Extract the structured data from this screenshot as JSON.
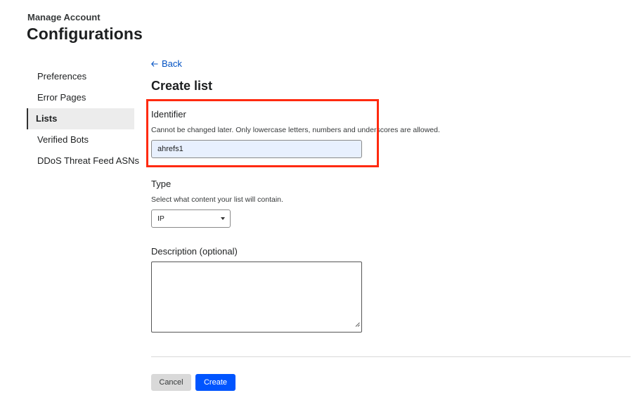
{
  "header": {
    "subtitle": "Manage Account",
    "title": "Configurations"
  },
  "sidebar": {
    "items": [
      {
        "label": "Preferences",
        "active": false
      },
      {
        "label": "Error Pages",
        "active": false
      },
      {
        "label": "Lists",
        "active": true
      },
      {
        "label": "Verified Bots",
        "active": false
      },
      {
        "label": "DDoS Threat Feed ASNs",
        "active": false
      }
    ]
  },
  "form": {
    "back_label": "Back",
    "title": "Create list",
    "identifier": {
      "label": "Identifier",
      "help": "Cannot be changed later. Only lowercase letters, numbers and underscores are allowed.",
      "value": "ahrefs1"
    },
    "type": {
      "label": "Type",
      "help": "Select what content your list will contain.",
      "selected": "IP"
    },
    "description": {
      "label": "Description (optional)",
      "value": ""
    },
    "cancel_label": "Cancel",
    "create_label": "Create"
  },
  "colors": {
    "accent": "#0055ff",
    "link": "#0051c3",
    "highlight": "#ff2a0f",
    "input_autofill_bg": "#e8f0fe"
  },
  "icons": {
    "back": "arrow-left-icon",
    "select": "caret-down-icon",
    "resize": "resize-handle-icon"
  }
}
